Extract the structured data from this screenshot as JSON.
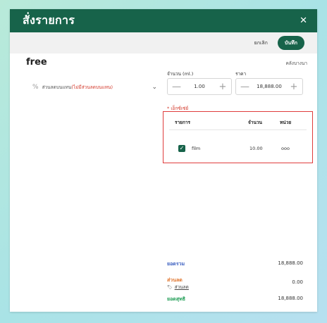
{
  "header": {
    "title": "สั่งรายการ",
    "close_icon": "✕"
  },
  "toolbar": {
    "cancel_label": "ยกเลิก",
    "save_label": "บันทึก"
  },
  "product": {
    "name": "free",
    "variant_label": "คลังบางนา"
  },
  "option": {
    "icon": "%",
    "text": "ส่วนลดบนแทน",
    "note": "(ไม่มีส่วนลดบนแทน)",
    "chevron": "⌄"
  },
  "quantity": {
    "label": "จำนวน (ml.)",
    "value": "1.00",
    "minus": "—",
    "plus": "+"
  },
  "price": {
    "label": "ราคา",
    "value": "18,888.00",
    "minus": "—",
    "plus": "+"
  },
  "addon": {
    "required_label": "* เอ็กซ์เซ่ย์",
    "headers": {
      "item": "รายการ",
      "qty": "จำนวน",
      "unit": "หน่วย"
    },
    "rows": [
      {
        "checked": true,
        "check_icon": "✓",
        "item": "film",
        "qty": "10.00",
        "unit": "ooo"
      }
    ]
  },
  "summary": {
    "total_label": "ยอดรวม",
    "total_value": "18,888.00",
    "discount_label": "ส่วนลด",
    "discount_value": "0.00",
    "discount_link": "ส่วนลด",
    "tag_icon": "🏷",
    "net_label": "ยอดสุทธิ",
    "net_value": "18,888.00"
  },
  "colors": {
    "brand": "#17634a",
    "blue_label": "#3b5fc0",
    "orange_label": "#e0742c",
    "green_label": "#1f9d55",
    "required_red": "#d33a2c"
  }
}
